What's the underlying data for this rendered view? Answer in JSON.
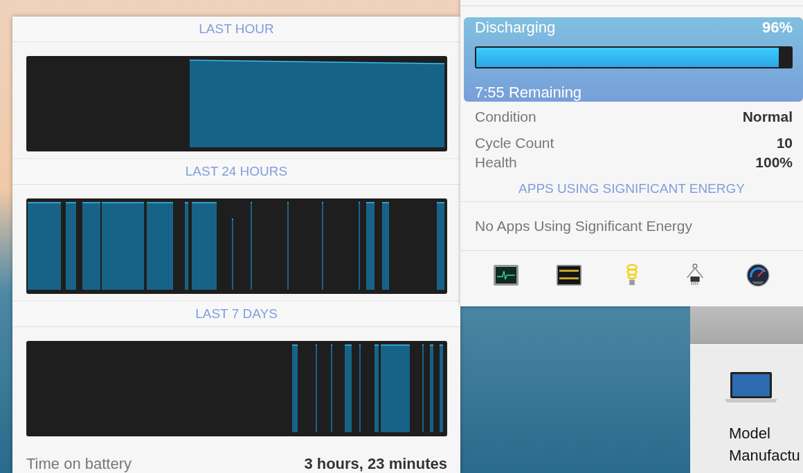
{
  "history": {
    "sections": [
      {
        "title": "LAST HOUR"
      },
      {
        "title": "LAST 24 HOURS"
      },
      {
        "title": "LAST 7 DAYS"
      }
    ],
    "time_on_battery": {
      "label": "Time on battery",
      "value": "3 hours, 23 minutes"
    }
  },
  "battery": {
    "status": "Discharging",
    "percent": "96%",
    "level": 0.96,
    "remaining": "7:55 Remaining",
    "details": [
      {
        "label": "Condition",
        "value": "Normal"
      },
      {
        "label": "Cycle Count",
        "value": "10"
      },
      {
        "label": "Health",
        "value": "100%"
      }
    ],
    "apps_header": "APPS USING SIGNIFICANT ENERGY",
    "apps_empty": "No Apps Using Significant Energy"
  },
  "about_window": {
    "labels": [
      "Model",
      "Manufactu"
    ]
  }
}
